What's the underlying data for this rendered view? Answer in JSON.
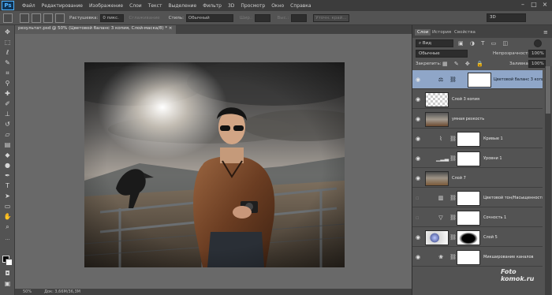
{
  "app": {
    "logo": "Ps"
  },
  "menu": [
    "Файл",
    "Редактирование",
    "Изображение",
    "Слои",
    "Текст",
    "Выделение",
    "Фильтр",
    "3D",
    "Просмотр",
    "Окно",
    "Справка"
  ],
  "options": {
    "feather_label": "Растушевка:",
    "feather_value": "0 пикс.",
    "antialias_label": "Сглаживание",
    "style_label": "Стиль:",
    "style_value": "Обычный",
    "width_label": "Шир.:",
    "height_label": "Выс.:",
    "refine_label": "Уточн. край...",
    "workspace": "3D"
  },
  "document": {
    "tab_title": "результат.psd @ 50% (Цветовой баланс 3 копия, Слой-маска/8) *",
    "zoom": "50%",
    "doc_size": "Док: 3,66M/36,3M"
  },
  "panel": {
    "tabs": [
      "Слои",
      "История",
      "Свойства"
    ],
    "filter_kind": "Вид",
    "blend_mode": "Обычные",
    "opacity_label": "Непрозрачность:",
    "opacity_value": "100%",
    "lock_label": "Закрепить:",
    "fill_label": "Заливка:",
    "fill_value": "100%",
    "layers": [
      {
        "name": "Цветовой баланс 3 копия",
        "selected": true,
        "kind": "adjust",
        "icon": "balance-icon"
      },
      {
        "name": "Слой 3 копия",
        "selected": false,
        "kind": "pixel"
      },
      {
        "name": "умная резкость",
        "selected": false,
        "kind": "photo"
      },
      {
        "name": "Кривые 1",
        "selected": false,
        "kind": "adjust",
        "icon": "curves-icon"
      },
      {
        "name": "Уровни 1",
        "selected": false,
        "kind": "adjust",
        "icon": "levels-icon"
      },
      {
        "name": "Слой 7",
        "selected": false,
        "kind": "photo"
      },
      {
        "name": "Цветовой тон/Насыщенность 1",
        "selected": false,
        "kind": "adjust",
        "icon": "hue-icon"
      },
      {
        "name": "Сочность 1",
        "selected": false,
        "kind": "adjust",
        "icon": "vibrance-icon"
      },
      {
        "name": "Слой 5",
        "selected": false,
        "kind": "masked"
      },
      {
        "name": "Микширование каналов",
        "selected": false,
        "kind": "adjust",
        "icon": "mixer-icon"
      }
    ]
  },
  "watermark": {
    "line1": "Foto",
    "line2": "komok.ru"
  }
}
